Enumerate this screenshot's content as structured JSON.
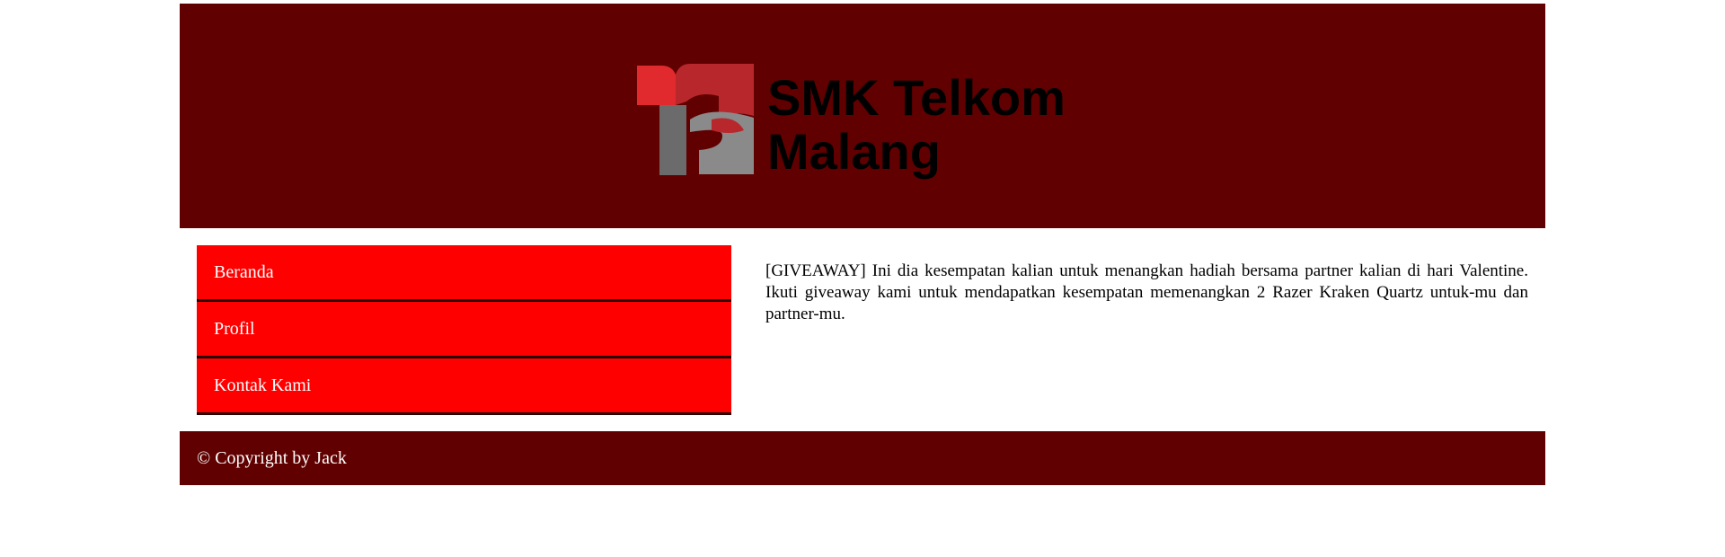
{
  "header": {
    "logo": {
      "icon": "smk-telkom-logo-icon",
      "line1": "SMK Telkom",
      "line2": "Malang"
    }
  },
  "menu": {
    "items": [
      {
        "label": "Beranda"
      },
      {
        "label": "Profil"
      },
      {
        "label": "Kontak Kami"
      }
    ]
  },
  "article": {
    "text": "[GIVEAWAY] Ini dia kesempatan kalian untuk menangkan hadiah bersama partner kalian di hari Valentine. Ikuti giveaway kami untuk mendapatkan kesempatan memenangkan 2 Razer Kraken Quartz untuk-mu dan partner-mu."
  },
  "footer": {
    "copyright": "© Copyright by Jack"
  },
  "colors": {
    "header_bg": "#600000",
    "menu_bg": "#ff0000",
    "footer_bg": "#600000"
  }
}
